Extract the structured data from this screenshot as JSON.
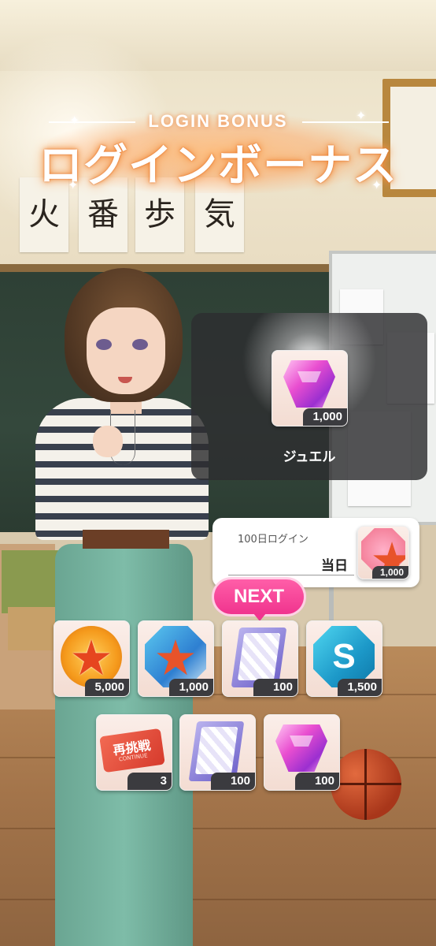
{
  "header": {
    "subtitle": "LOGIN BONUS",
    "title": "ログインボーナス"
  },
  "reward_popup": {
    "item_icon": "jewel-icon",
    "quantity": "1,000",
    "item_name": "ジュエル"
  },
  "milestone": {
    "label": "100日ログイン",
    "status": "当日",
    "item_icon": "star-badge-red-icon",
    "quantity": "1,000"
  },
  "next_badge": "NEXT",
  "rewards_row1": [
    {
      "icon": "star-medal-icon",
      "quantity": "5,000"
    },
    {
      "icon": "star-badge-blue-icon",
      "quantity": "1,000"
    },
    {
      "icon": "book-icon",
      "quantity": "100"
    },
    {
      "icon": "s-coin-icon",
      "quantity": "1,500"
    }
  ],
  "rewards_row2": [
    {
      "icon": "retry-ticket-icon",
      "quantity": "3",
      "ticket_text": "再挑戦",
      "ticket_sub": "CONTINUE"
    },
    {
      "icon": "book-icon",
      "quantity": "100"
    },
    {
      "icon": "jewel-icon",
      "quantity": "100"
    }
  ],
  "scene": {
    "calligraphy": [
      "火",
      "番",
      "歩",
      "気"
    ],
    "s_letter": "S"
  },
  "colors": {
    "accent": "#f0348e",
    "title_glow": "#f08a3a",
    "popup_bg": "#2d2d30"
  }
}
